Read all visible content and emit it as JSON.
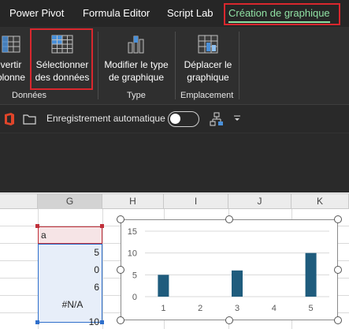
{
  "ribbon": {
    "tabs": [
      {
        "label": "Power Pivot"
      },
      {
        "label": "Formula Editor"
      },
      {
        "label": "Script Lab"
      },
      {
        "label": "Création de graphique",
        "active": true
      }
    ],
    "buttons": {
      "switch_row_col": {
        "label_line1": "vertir",
        "label_line2": "olonne",
        "icon": "switch-row-column-icon"
      },
      "select_data": {
        "label_line1": "Sélectionner",
        "label_line2": "des données",
        "icon": "select-data-icon"
      },
      "change_type": {
        "label_line1": "Modifier le type",
        "label_line2": "de graphique",
        "icon": "change-chart-type-icon"
      },
      "move_chart": {
        "label_line1": "Déplacer le",
        "label_line2": "graphique",
        "icon": "move-chart-icon"
      }
    },
    "groups": {
      "data": "Données",
      "type": "Type",
      "location": "Emplacement"
    },
    "highlight_color": "#d9272e",
    "active_tab_color": "#8fe0a3"
  },
  "qat": {
    "office_icon": "office-icon",
    "open_icon": "folder-icon",
    "autosave_label": "Enregistrement automatique",
    "autosave_on": false,
    "extra_icon": "hierarchy-icon",
    "customize_icon": "customize-dropdown-icon"
  },
  "sheet": {
    "columns": [
      "G",
      "H",
      "I",
      "J",
      "K"
    ],
    "selected_column": "G",
    "cells": [
      {
        "value": "a",
        "kind": "header"
      },
      {
        "value": "5",
        "kind": "num"
      },
      {
        "value": "0",
        "kind": "num"
      },
      {
        "value": "6",
        "kind": "num"
      },
      {
        "value": "#N/A",
        "kind": "err"
      },
      {
        "value": "10",
        "kind": "num"
      }
    ],
    "series_range_color": "#2f6fcb",
    "name_range_color": "#c0303a"
  },
  "chart_data": {
    "type": "bar",
    "categories": [
      "1",
      "2",
      "3",
      "4",
      "5"
    ],
    "values": [
      5,
      0,
      6,
      null,
      10
    ],
    "ylim": [
      0,
      15
    ],
    "yticks": [
      0,
      5,
      10,
      15
    ],
    "grid": true,
    "bar_color": "#1f5c7d"
  }
}
